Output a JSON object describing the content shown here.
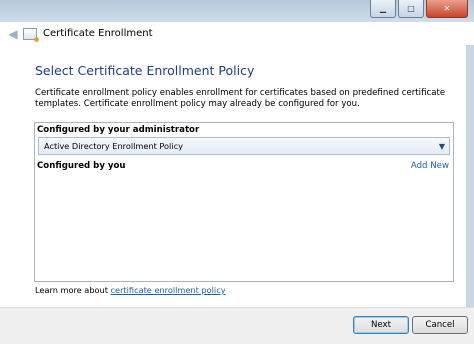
{
  "window": {
    "title": "Certificate Enrollment"
  },
  "page": {
    "heading": "Select Certificate Enrollment Policy",
    "description": "Certificate enrollment policy enables enrollment for certificates based on predefined certificate templates. Certificate enrollment policy may already be configured for you."
  },
  "policy_list": {
    "admin_header": "Configured by your administrator",
    "admin_policy": "Active Directory Enrollment Policy",
    "user_header": "Configured by you",
    "add_new": "Add New"
  },
  "learn_more": {
    "prefix": "Learn more about ",
    "link": "certificate enrollment policy"
  },
  "buttons": {
    "next": "Next",
    "cancel": "Cancel"
  }
}
